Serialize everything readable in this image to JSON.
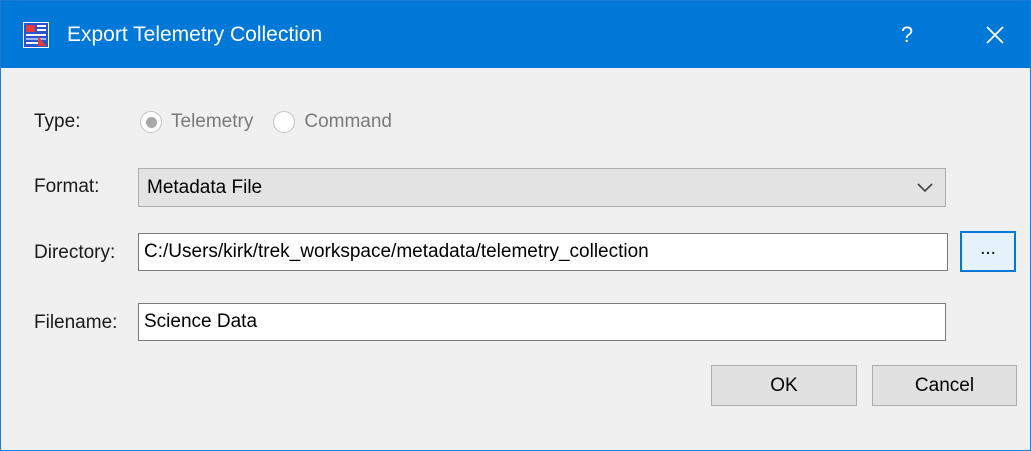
{
  "window": {
    "title": "Export Telemetry Collection",
    "help_label": "?",
    "icon": "app-data-icon",
    "close_icon": "close-icon",
    "titlebar_color": "#0078d7"
  },
  "form": {
    "type": {
      "label": "Type:",
      "options": [
        {
          "label": "Telemetry",
          "selected": true,
          "enabled": false
        },
        {
          "label": "Command",
          "selected": false,
          "enabled": false
        }
      ]
    },
    "format": {
      "label": "Format:",
      "value": "Metadata File",
      "dropdown_icon": "chevron-down-icon"
    },
    "directory": {
      "label": "Directory:",
      "value": "C:/Users/kirk/trek_workspace/metadata/telemetry_collection",
      "browse_label": "..."
    },
    "filename": {
      "label": "Filename:",
      "value": "Science Data"
    }
  },
  "buttons": {
    "ok": "OK",
    "cancel": "Cancel"
  },
  "colors": {
    "accent": "#0078d7",
    "background": "#f0f0f0"
  }
}
